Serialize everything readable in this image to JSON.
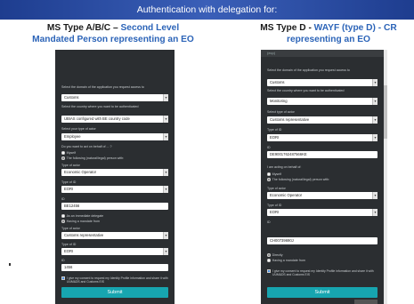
{
  "header": {
    "title": "Authentication with delegation for:"
  },
  "left_title": {
    "line1_black": "MS Type A/B/C – ",
    "line1_blue": "Second Level",
    "line2": "Mandated Person representing an EO"
  },
  "right_title": {
    "line1_black": "MS Type D - ",
    "line1_blue": "WAYF (type D) - CR",
    "line2": "representing an EO"
  },
  "left_form": {
    "domain_label": "Select the domain of the application you request access to",
    "domain_value": "Customs",
    "country_label": "Select the country where you want to be authenticated",
    "country_value": "UBIAS configured with BE country code",
    "actor_type_label": "Select your type of actor",
    "actor_type_value": "Employee",
    "behalf_label": "Do you want to act on behalf of ... ?",
    "radio_myself": "Myself",
    "radio_following": "The following (natural/legal) person with:",
    "type_actor_label": "Type of actor",
    "type_actor_value": "Economic Operator",
    "type_id_label": "Type of ID",
    "type_id_value": "EORI",
    "id_label": "ID",
    "id_value": "BE12456",
    "radio_immediate": "As an immediate delegate",
    "radio_mandate": "Having a mandate from",
    "type_actor2_label": "Type of actor",
    "type_actor2_value": "Customs representative",
    "type_id2_label": "Type of ID",
    "type_id2_value": "EORI",
    "id2_label": "ID",
    "id2_value": "1456",
    "consent": "I give my consent to request my Identity Profile information and share it with UUM&DS and Customs EIS",
    "submit": "Submit"
  },
  "right_form": {
    "top_value": "(ecp)",
    "domain_label": "Select the domain of the application you request access to",
    "domain_value": "Customs",
    "country_label": "Select the country where you want to be authenticated",
    "country_value": "Monitoring",
    "actor_type_label": "Select type of actor",
    "actor_type_value": "Customs representative",
    "type_id_label": "Type of ID",
    "type_id_value": "EORI",
    "id_label": "ID",
    "id_value": "DE9001762487566KE",
    "acting_label": "I am acting on behalf of:",
    "radio_myself": "Myself",
    "radio_following": "The following (natural/legal) person with:",
    "type_actor_label": "Type of actor",
    "type_actor_value": "Economic Operator",
    "type_id2_label": "Type of ID",
    "type_id2_value": "EORI",
    "id2_label": "ID",
    "id2_value": "CH00739690J",
    "radio_directly": "Directly",
    "radio_mandate": "Having a mandate from",
    "consent": "I give my consent to request my Identity Profile information and share it with UUM&DS and Customs EIS",
    "submit": "Submit"
  },
  "colors": {
    "header": "#2c4fa0",
    "panel": "#2b2e31",
    "button": "#17a5b0",
    "accent_blue": "#2c64b8"
  }
}
